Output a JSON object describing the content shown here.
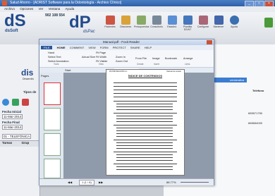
{
  "window": {
    "title": "Salud Ahorro - [ADRIST Software para la Odontología - Archivo Clínico]"
  },
  "menu": [
    "Archivo",
    "Opciones",
    "Ver",
    "Ventana",
    "Ayuda"
  ],
  "app": {
    "logo1": "dS",
    "logo1_sub": "dsSoft",
    "phone": "902 108 554",
    "logo2": "dP",
    "logo2_sub": "dsPac"
  },
  "toolbar": [
    "Pacientes",
    "Citaciones",
    "Presupuestos",
    "Consultorio",
    "Estadist.",
    "Plantilla DS/NT",
    "Configurar",
    "Mantener",
    "Ayuda"
  ],
  "left": {
    "heading": "dis",
    "sub": "Desarrollo",
    "tipo_label": "Tipos de",
    "fecha_inicial_label": "Fecha Inicial",
    "fecha_inicial": "11-Mar-2014",
    "fecha_final_label": "Fecha Final",
    "fecha_final": "11-Mar-2014",
    "filter": "01 - TELEFÓNICA",
    "col1": "Tareas",
    "col2": "Grup"
  },
  "right": {
    "col_telefono": "Teléfono",
    "row1": "655571750",
    "row2": "665654000",
    "blue_text": "ministrativa"
  },
  "pdf": {
    "title": "Manual.pdf - Foxit Reader",
    "tabs": [
      "FILE",
      "HOME",
      "COMMENT",
      "VIEW",
      "FORM",
      "PROTECT",
      "SHARE",
      "HELP"
    ],
    "ribbon": {
      "hand": "Hand",
      "select_text": "Select Text",
      "select_annotation": "Select Annotation",
      "actual_size": "Actual Size",
      "fit_page": "Fit Page",
      "fit_width": "Fit Width",
      "fit_visible": "Fit Visible",
      "zoom_in": "Zoom In",
      "zoom_out": "Zoom Out",
      "from_file": "From File",
      "image": "Image",
      "bookmark": "Bookmark",
      "arrange": "Arrange",
      "group_tools": "Tools",
      "group_view": "View",
      "group_create": "Create",
      "group_insert": "Insert",
      "group_links": "Links"
    },
    "doc_tabs": [
      "Start",
      "Manual.pdf"
    ],
    "pane_label": "Pages",
    "page_title": "ÍNDICE DE CONTENIDOS",
    "page_header_left": "DS PROTECCIÓN S.L.",
    "page_header_right": "Manual de usuario",
    "page_indicator": "1 (1 / 8)",
    "zoom": "88.77%"
  }
}
